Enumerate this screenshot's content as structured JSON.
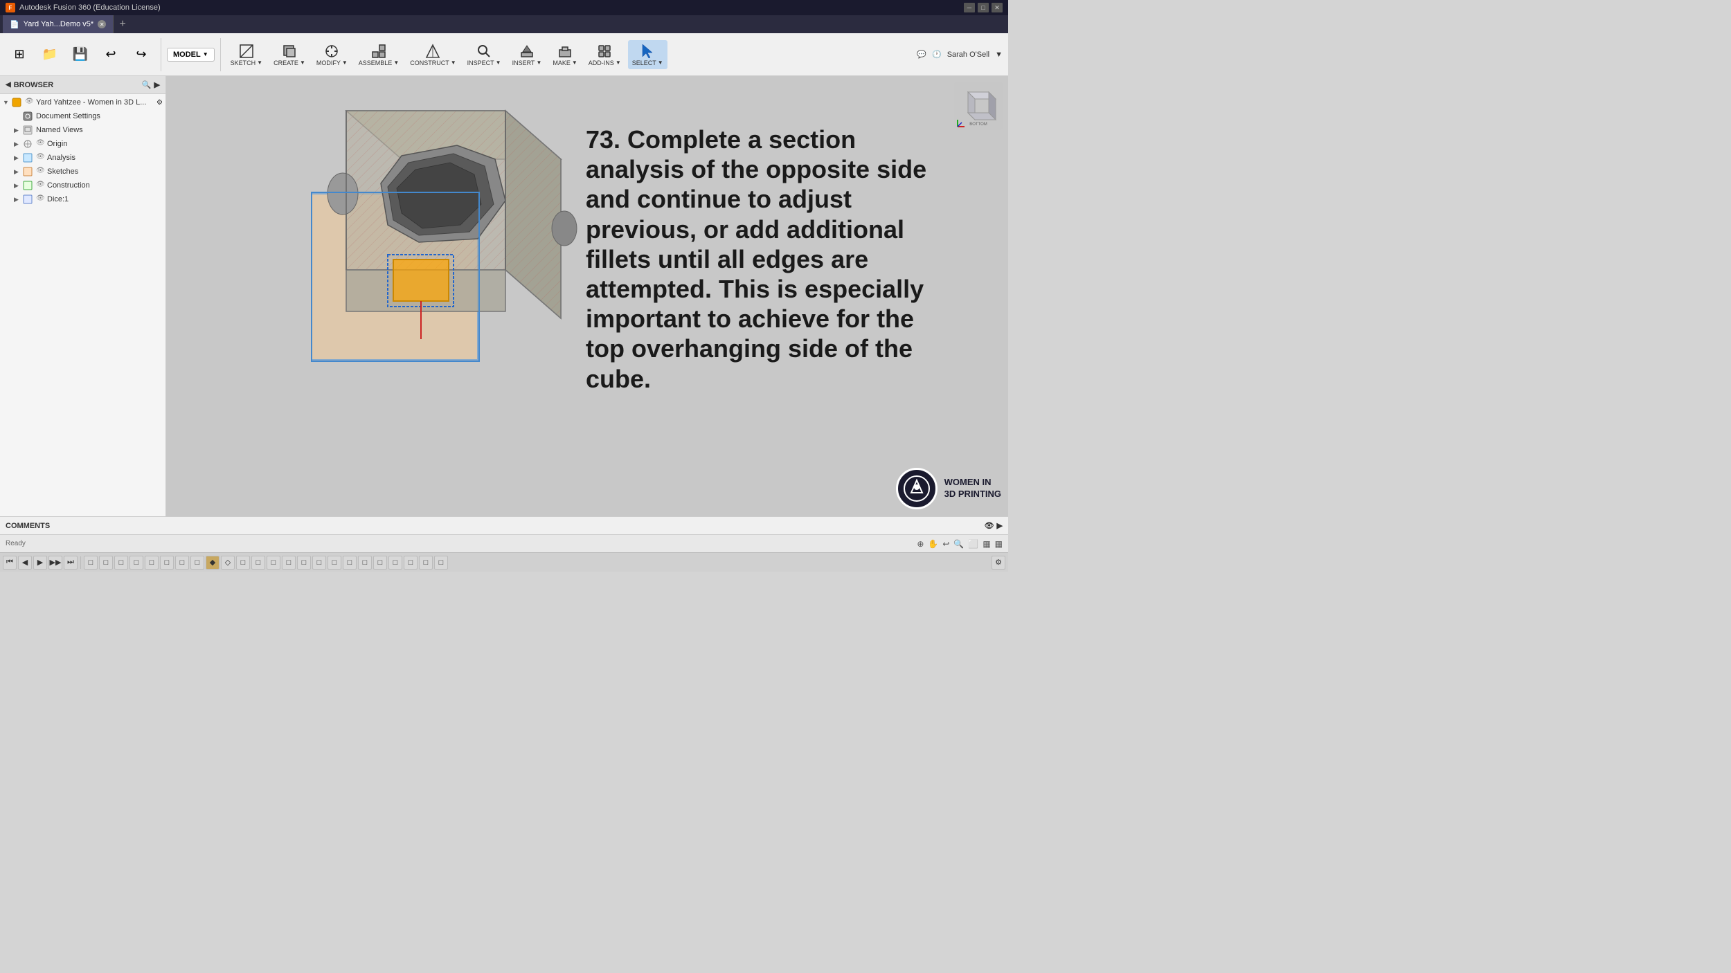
{
  "app": {
    "title": "Autodesk Fusion 360 (Education License)",
    "icon": "F"
  },
  "tabs": [
    {
      "label": "Yard Yah...Demo v5*",
      "active": true
    },
    {
      "add_label": "+"
    }
  ],
  "toolbar": {
    "model_selector": "MODEL",
    "groups": [
      {
        "label": "SKETCH",
        "icon": "✏️"
      },
      {
        "label": "CREATE",
        "icon": "📦"
      },
      {
        "label": "MODIFY",
        "icon": "🔧"
      },
      {
        "label": "ASSEMBLE",
        "icon": "🔩"
      },
      {
        "label": "CONSTRUCT",
        "icon": "📐"
      },
      {
        "label": "INSPECT",
        "icon": "🔍"
      },
      {
        "label": "INSERT",
        "icon": "⬇️"
      },
      {
        "label": "MAKE",
        "icon": "🏭"
      },
      {
        "label": "ADD-INS",
        "icon": "🧩"
      },
      {
        "label": "SELECT",
        "icon": "▶"
      }
    ],
    "user": "Sarah O'Sell",
    "undo_label": "↩",
    "redo_label": "↪"
  },
  "sidebar": {
    "header": "BROWSER",
    "root_label": "Yard Yahtzee - Women in 3D L...",
    "items": [
      {
        "label": "Document Settings",
        "level": 1,
        "type": "settings",
        "expandable": false
      },
      {
        "label": "Named Views",
        "level": 1,
        "type": "folder",
        "expandable": false
      },
      {
        "label": "Origin",
        "level": 1,
        "type": "origin",
        "expandable": true,
        "eye": true
      },
      {
        "label": "Analysis",
        "level": 1,
        "type": "folder",
        "expandable": true,
        "eye": true
      },
      {
        "label": "Sketches",
        "level": 1,
        "type": "folder",
        "expandable": true,
        "eye": true
      },
      {
        "label": "Construction",
        "level": 1,
        "type": "folder",
        "expandable": true,
        "eye": true
      },
      {
        "label": "Dice:1",
        "level": 1,
        "type": "component",
        "expandable": true,
        "eye": true
      }
    ]
  },
  "viewport": {
    "background": "#c8c8c8"
  },
  "instruction": {
    "text": "73. Complete a section analysis of the opposite side and continue to adjust previous, or add additional fillets until all edges are attempted. This is especially important to achieve for the top overhanging side of the cube."
  },
  "wi3dp": {
    "name": "WOMEN IN 3D PRINTING"
  },
  "comments": {
    "label": "COMMENTS"
  },
  "status": {
    "icons": [
      "⊕",
      "↔",
      "↩",
      "🔍",
      "⬜",
      "▦",
      "▦"
    ]
  },
  "cube_nav": {
    "label": "BOTTOM"
  },
  "bottom_toolbar": {
    "buttons": [
      "◀◀",
      "◀",
      "▶",
      "▶▶",
      "⏩",
      "□",
      "□",
      "□",
      "□",
      "□",
      "□",
      "□",
      "□",
      "◆",
      "◇",
      "□",
      "□",
      "□",
      "□",
      "□",
      "□",
      "□",
      "□",
      "□",
      "□",
      "□",
      "□",
      "□",
      "□",
      "⚙"
    ]
  }
}
